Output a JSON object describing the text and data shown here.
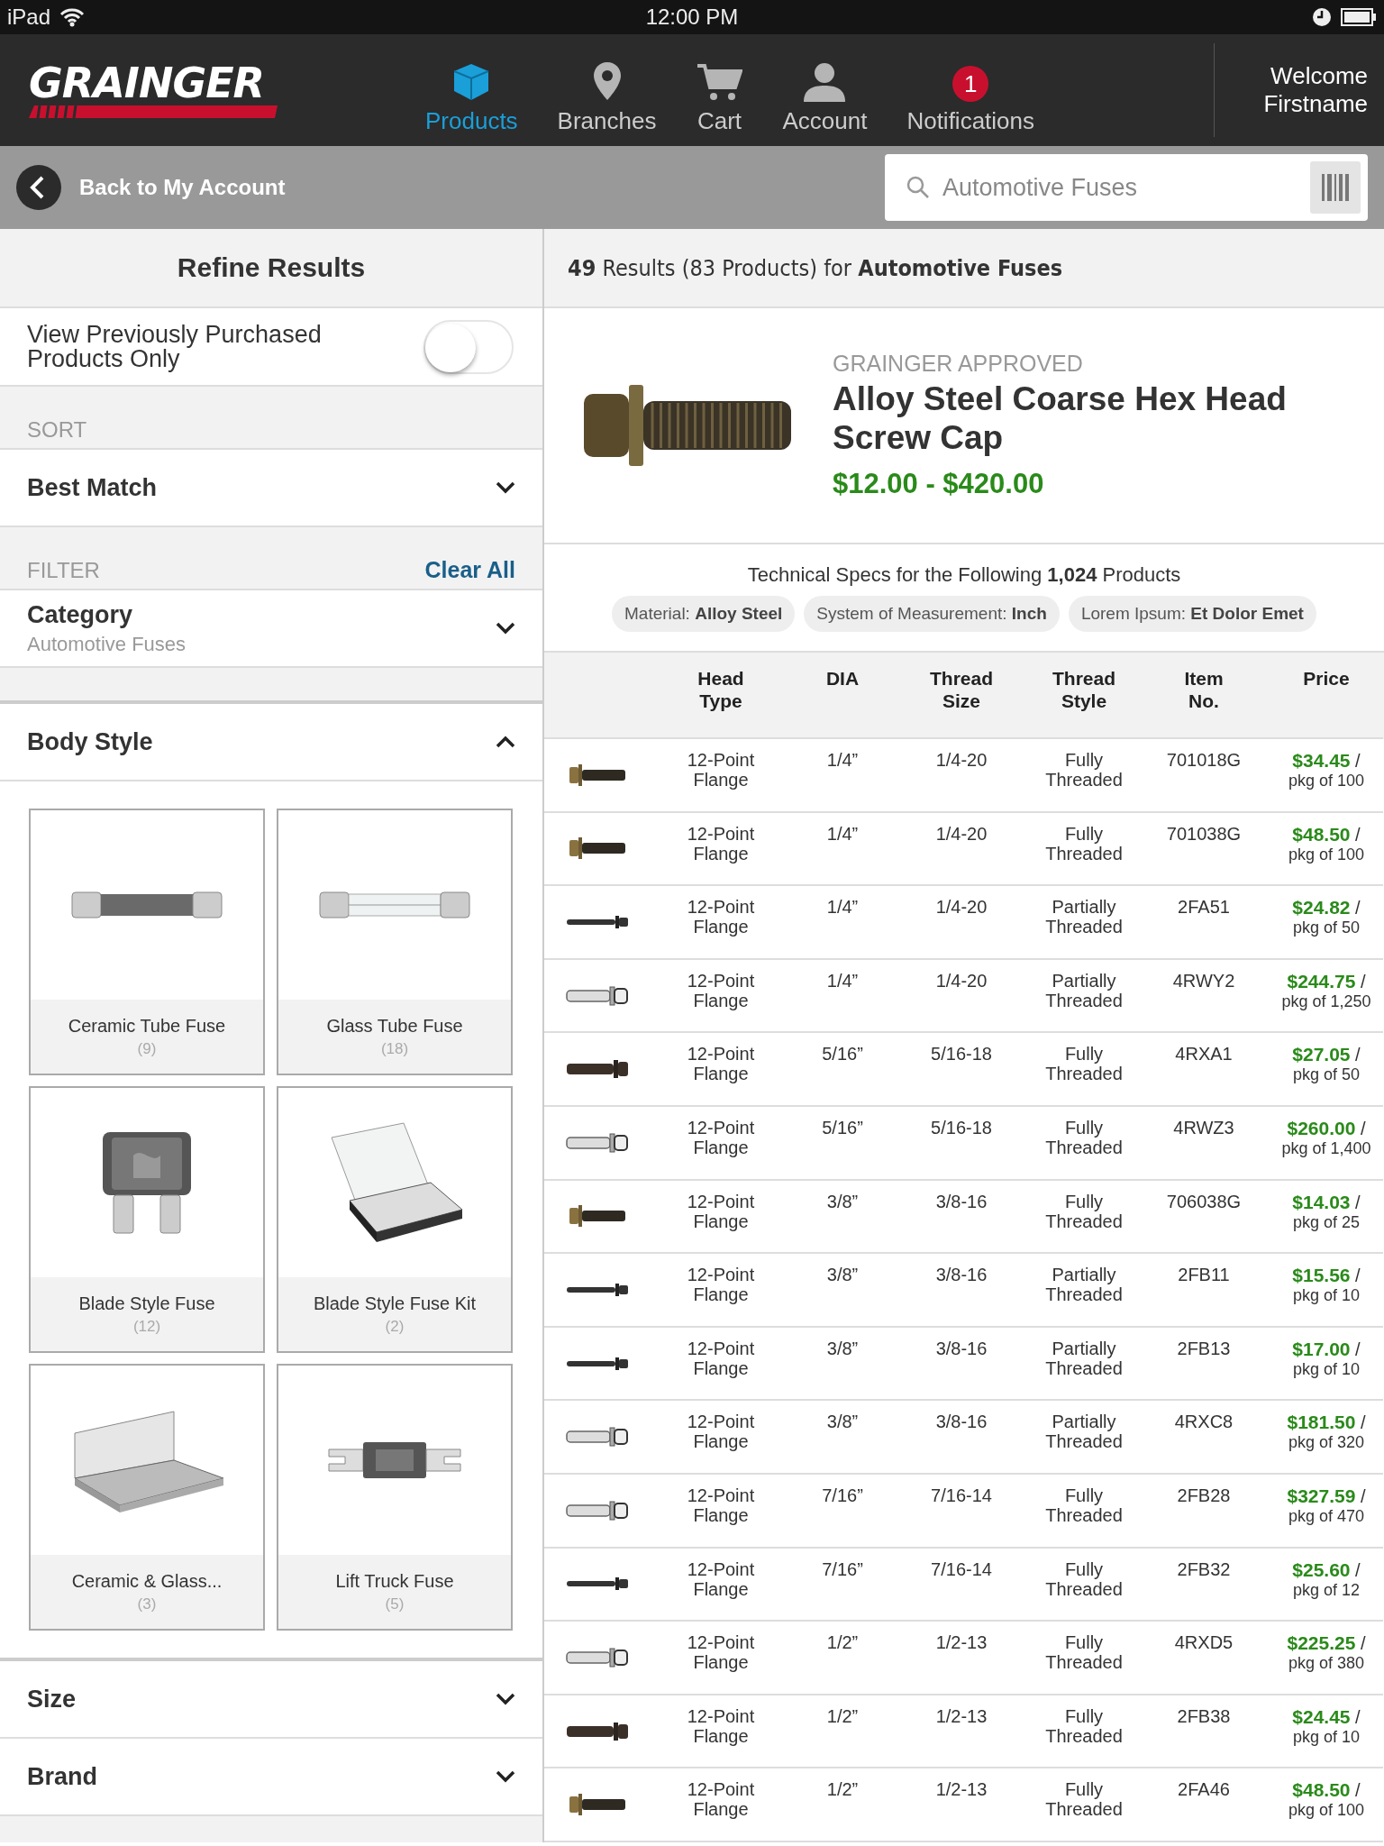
{
  "status_bar": {
    "device": "iPad",
    "time": "12:00 PM"
  },
  "header": {
    "logo": "GRAINGER",
    "nav": [
      {
        "label": "Products",
        "selected": true
      },
      {
        "label": "Branches",
        "selected": false
      },
      {
        "label": "Cart",
        "selected": false
      },
      {
        "label": "Account",
        "selected": false
      },
      {
        "label": "Notifications",
        "badge": "1",
        "selected": false
      }
    ],
    "welcome": "Welcome Firstname"
  },
  "subheader": {
    "back": "Back to My Account",
    "search": {
      "placeholder": "Automotive Fuses"
    }
  },
  "refine": {
    "title": "Refine Results",
    "toggle": {
      "label": "View Previously Purchased Products Only",
      "on": false
    },
    "sort": {
      "label": "SORT",
      "value": "Best Match",
      "expanded": false
    },
    "filter": {
      "label": "FILTER",
      "clear": "Clear All"
    },
    "filters": [
      {
        "title": "Category",
        "value": "Automotive Fuses",
        "expanded": false
      }
    ],
    "body_style": {
      "title": "Body Style",
      "expanded": true,
      "cards": [
        {
          "label": "Ceramic Tube Fuse",
          "count": "(9)"
        },
        {
          "label": "Glass Tube Fuse",
          "count": "(18)"
        },
        {
          "label": "Blade Style Fuse",
          "count": "(12)"
        },
        {
          "label": "Blade Style Fuse Kit",
          "count": "(2)"
        },
        {
          "label": "Ceramic & Glass...",
          "count": "(3)"
        },
        {
          "label": "Lift Truck Fuse",
          "count": "(5)"
        }
      ]
    },
    "more": [
      {
        "title": "Size",
        "expanded": false
      },
      {
        "title": "Brand",
        "expanded": false
      }
    ]
  },
  "results": {
    "summary": "**49** Results (83 Products) for **Automotive Fuses**",
    "product": {
      "badge": "GRAINGER APPROVED",
      "name": "Alloy Steel Coarse Hex Head Screw Cap",
      "price": "$12.00 - $420.00"
    },
    "specs_title": "Technical Specs for the Following **1,024** Products",
    "specs": [
      "Material: **Alloy Steel**",
      "System of Measurement: **Inch**",
      "Lorem Ipsum: **Et Dolor Emet**"
    ],
    "table": {
      "columns": [
        "Head Type",
        "DIA",
        "Thread Size",
        "Thread Style",
        "Item No.",
        "Price"
      ],
      "rows": [
        {
          "head": "12-Point Flange",
          "dia": "1/4”",
          "size": "1/4-20",
          "style": "Fully Threaded",
          "item": "701018G",
          "price": "**$34.45** /",
          "package": "pkg of 100"
        },
        {
          "head": "12-Point Flange",
          "dia": "1/4”",
          "size": "1/4-20",
          "style": "Fully Threaded",
          "item": "701038G",
          "price": "**$48.50** /",
          "package": "pkg of 100"
        },
        {
          "head": "12-Point Flange",
          "dia": "1/4”",
          "size": "1/4-20",
          "style": "Partially Threaded",
          "item": "2FA51",
          "price": "**$24.82** /",
          "package": "pkg of 50"
        },
        {
          "head": "12-Point Flange",
          "dia": "1/4”",
          "size": "1/4-20",
          "style": "Partially Threaded",
          "item": "4RWY2",
          "price": "**$244.75** /",
          "package": "pkg of 1,250"
        },
        {
          "head": "12-Point Flange",
          "dia": "5/16”",
          "size": "5/16-18",
          "style": "Fully Threaded",
          "item": "4RXA1",
          "price": "**$27.05** /",
          "package": "pkg of 50"
        },
        {
          "head": "12-Point Flange",
          "dia": "5/16”",
          "size": "5/16-18",
          "style": "Fully Threaded",
          "item": "4RWZ3",
          "price": "**$260.00** /",
          "package": "pkg of 1,400"
        },
        {
          "head": "12-Point Flange",
          "dia": "3/8”",
          "size": "3/8-16",
          "style": "Fully Threaded",
          "item": "706038G",
          "price": "**$14.03** /",
          "package": "pkg of 25"
        },
        {
          "head": "12-Point Flange",
          "dia": "3/8”",
          "size": "3/8-16",
          "style": "Partially Threaded",
          "item": "2FB11",
          "price": "**$15.56** /",
          "package": "pkg of 10"
        },
        {
          "head": "12-Point Flange",
          "dia": "3/8”",
          "size": "3/8-16",
          "style": "Partially Threaded",
          "item": "2FB13",
          "price": "**$17.00** /",
          "package": "pkg of 10"
        },
        {
          "head": "12-Point Flange",
          "dia": "3/8”",
          "size": "3/8-16",
          "style": "Partially Threaded",
          "item": "4RXC8",
          "price": "**$181.50** /",
          "package": "pkg of 320"
        },
        {
          "head": "12-Point Flange",
          "dia": "7/16”",
          "size": "7/16-14",
          "style": "Fully Threaded",
          "item": "2FB28",
          "price": "**$327.59** /",
          "package": "pkg of 470"
        },
        {
          "head": "12-Point Flange",
          "dia": "7/16”",
          "size": "7/16-14",
          "style": "Fully Threaded",
          "item": "2FB32",
          "price": "**$25.60** /",
          "package": "pkg of 12"
        },
        {
          "head": "12-Point Flange",
          "dia": "1/2”",
          "size": "1/2-13",
          "style": "Fully Threaded",
          "item": "4RXD5",
          "price": "**$225.25** /",
          "package": "pkg of 380"
        },
        {
          "head": "12-Point Flange",
          "dia": "1/2”",
          "size": "1/2-13",
          "style": "Fully Threaded",
          "item": "2FB38",
          "price": "**$24.45** /",
          "package": "pkg of 10"
        },
        {
          "head": "12-Point Flange",
          "dia": "1/2”",
          "size": "1/2-13",
          "style": "Fully Threaded",
          "item": "2FA46",
          "price": "**$48.50** /",
          "package": "pkg of 100"
        }
      ]
    }
  }
}
